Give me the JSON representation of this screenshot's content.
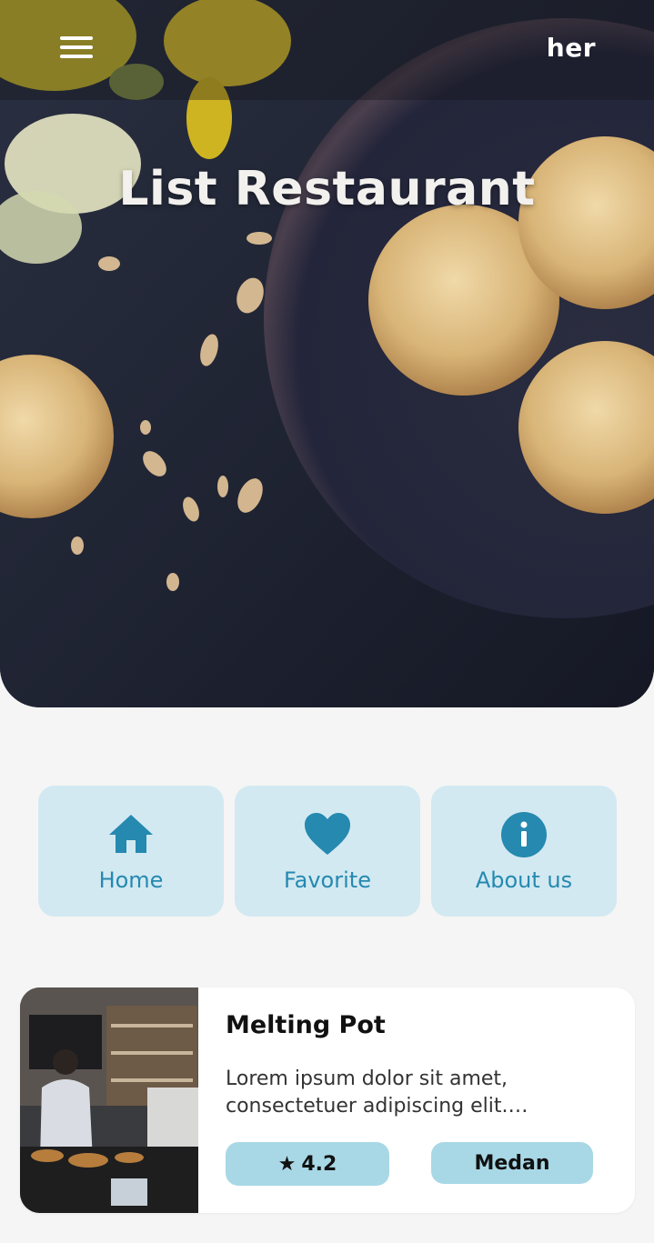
{
  "app": {
    "brand": "her",
    "hero_title": "List Restaurant"
  },
  "nav": {
    "items": [
      {
        "label": "Home",
        "icon": "home-icon"
      },
      {
        "label": "Favorite",
        "icon": "heart-icon"
      },
      {
        "label": "About us",
        "icon": "info-icon"
      }
    ]
  },
  "restaurants": [
    {
      "name": "Melting Pot",
      "description": "Lorem ipsum dolor sit amet, consectetuer adipiscing elit. Aenean…",
      "rating": "4.2",
      "city": "Medan"
    }
  ],
  "colors": {
    "accent": "#2589b0",
    "nav_card_bg": "#d2e9f1",
    "pill_bg": "#a8d8e6",
    "page_bg": "#f5f5f5"
  }
}
